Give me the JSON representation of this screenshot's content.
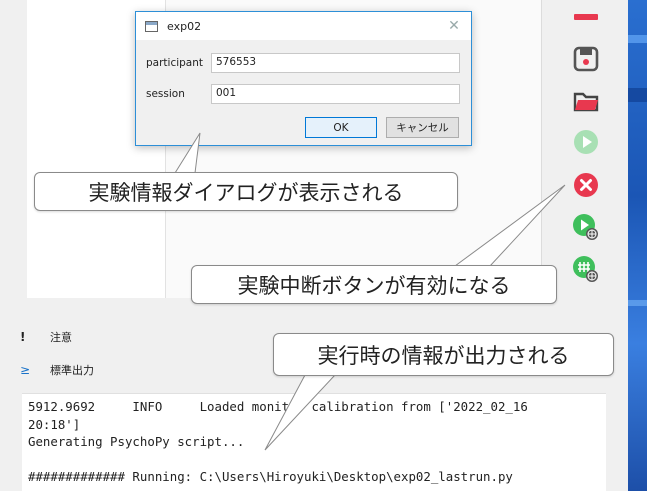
{
  "dialog": {
    "title": "exp02",
    "close_glyph": "✕",
    "fields": [
      {
        "label": "participant",
        "value": "576553"
      },
      {
        "label": "session",
        "value": "001"
      }
    ],
    "ok_label": "OK",
    "cancel_label": "キャンセル"
  },
  "toolbar": {
    "icons": [
      "minus-icon",
      "save-icon",
      "folder-icon",
      "run-icon",
      "stop-icon",
      "run-online-icon",
      "pilot-online-icon"
    ],
    "colors": {
      "red": "#e8384f",
      "green_disabled": "#a8e0b4",
      "green": "#3fbf5c",
      "dark": "#555555"
    }
  },
  "panels": {
    "alerts_label": "注意",
    "alerts_icon": "!",
    "stdout_label": "標準出力",
    "stdout_icon": "≥"
  },
  "output": {
    "lines": [
      "5912.9692     INFO     Loaded monitor calibration from ['2022_02_16",
      "20:18']",
      "Generating PsychoPy script...",
      "",
      "############# Running: C:\\Users\\Hiroyuki\\Desktop\\exp02_lastrun.py"
    ]
  },
  "callouts": {
    "dialog_note": "実験情報ダイアログが表示される",
    "stop_note": "実験中断ボタンが有効になる",
    "output_note": "実行時の情報が出力される"
  }
}
